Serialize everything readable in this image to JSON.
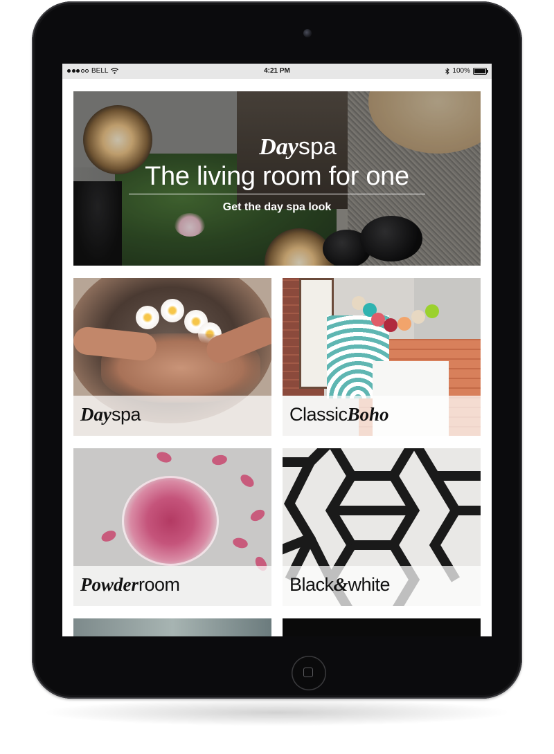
{
  "status_bar": {
    "carrier": "BELL",
    "time": "4:21 PM",
    "battery": "100%",
    "icons": [
      "signal-dots-icon",
      "wifi-icon",
      "bluetooth-icon",
      "battery-icon"
    ]
  },
  "hero": {
    "brand_bold": "Day",
    "brand_light": "spa",
    "title": "The living room for one",
    "subtitle": "Get the day spa look"
  },
  "tiles": [
    {
      "bold": "Day",
      "light": "spa"
    },
    {
      "light": "Classic",
      "bold": "Boho"
    },
    {
      "bold": "Powder",
      "light": "room"
    },
    {
      "light_a": "Black",
      "bold": "&",
      "light_b": "white"
    }
  ],
  "colors": {
    "device_body": "#0b0b0d",
    "status_bar": "#e7e7e7",
    "screen_bg": "#ffffff",
    "label_overlay": "rgba(255,255,255,0.72)"
  }
}
